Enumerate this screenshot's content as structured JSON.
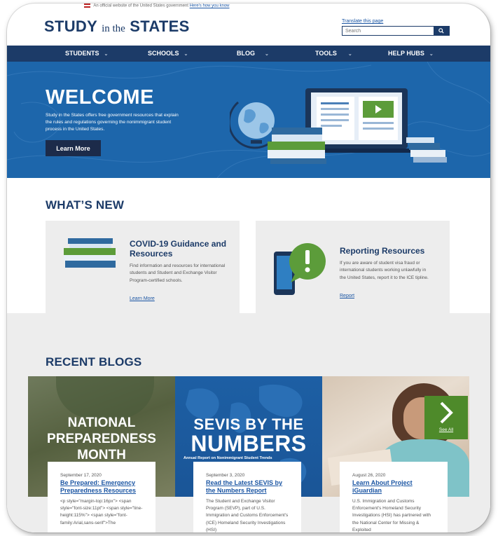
{
  "gov_banner": {
    "text": "An official website of the United States government",
    "link": "Here's how you know"
  },
  "header": {
    "logo_study": "STUDY",
    "logo_in_the": "in the",
    "logo_states": "STATES",
    "translate_label": "Translate this page",
    "search_placeholder": "Search",
    "search_icon": "magnifier-icon"
  },
  "nav": {
    "items": [
      {
        "label": "STUDENTS"
      },
      {
        "label": "SCHOOLS"
      },
      {
        "label": "BLOG"
      },
      {
        "label": "TOOLS"
      },
      {
        "label": "HELP HUBS"
      }
    ]
  },
  "hero": {
    "title": "WELCOME",
    "text": "Study in the States offers free government resources that explain the rules and regulations governing the nonimmigrant student process in the United States.",
    "button_label": "Learn More"
  },
  "whats_new": {
    "title": "WHAT’S NEW",
    "cards": [
      {
        "title": "COVID-19 Guidance and Resources",
        "text": "Find information and resources for international students and Student and Exchange Visitor Program-certified schools.",
        "link": "Learn More",
        "icon": "books-icon"
      },
      {
        "title": "Reporting Resources",
        "text": "If you are aware of student visa fraud or international students working unlawfully in the United States, report it to the ICE tipline.",
        "link": "Report",
        "icon": "phone-alert-icon"
      }
    ]
  },
  "recent_blogs": {
    "title": "RECENT BLOGS",
    "see_all": "See All",
    "posts": [
      {
        "image_text_1": "NATIONAL",
        "image_text_2": "PREPAREDNESS",
        "image_text_3": "MONTH",
        "date": "September 17, 2020",
        "title": "Be Prepared: Emergency Preparedness Resources",
        "body": "<p style=\"margin-top:16px\"> <span style=\"font-size:11pt\"> <span style=\"line-height:115%\"> <span style=\"font-family:Arial,sans-serif\">The"
      },
      {
        "image_text_1": "SEVIS BY THE",
        "image_text_2": "NUMBERS",
        "image_text_3": "Annual Report on Nonimmigrant Student Trends",
        "date": "September 3, 2020",
        "title": "Read the Latest SEVIS by the Numbers Report",
        "body": "The Student and Exchange Visitor Program (SEVP), part of U.S. Immigration and Customs Enforcement's (ICE) Homeland Security Investigations (HSI)"
      },
      {
        "date": "August 26, 2020",
        "title": "Learn About Project iGuardian",
        "body": "U.S. Immigration and Customs Enforcement's Homeland Security Investigations (HSI) has partnered with the National Center for Missing & Exploited"
      }
    ]
  },
  "colors": {
    "navy": "#1c3b68",
    "hero_blue": "#1d66ab",
    "link_blue": "#1a55a3",
    "green": "#4e8a2a"
  }
}
